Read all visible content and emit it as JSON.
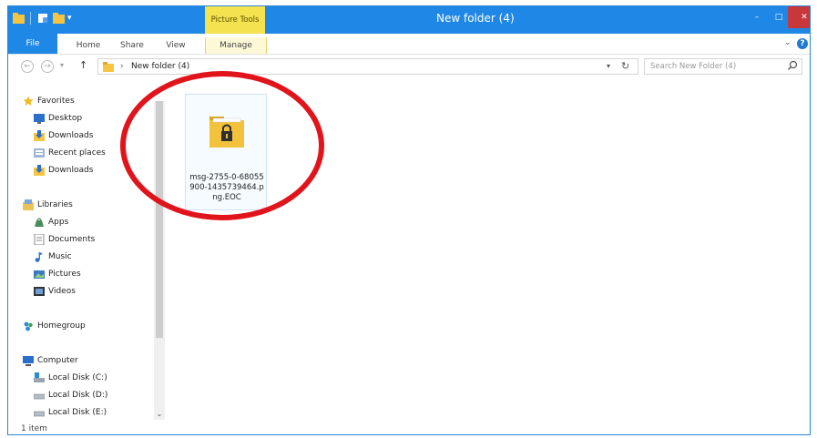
{
  "window": {
    "title": "New folder (4)",
    "context_tab": "Picture Tools",
    "controls": {
      "minimize": "–",
      "maximize": "□",
      "close": "✕"
    }
  },
  "ribbon": {
    "tabs": [
      {
        "label": "File"
      },
      {
        "label": "Home"
      },
      {
        "label": "Share"
      },
      {
        "label": "View"
      },
      {
        "label": "Manage"
      }
    ],
    "help": "?"
  },
  "address": {
    "path": "New folder (4)",
    "search_placeholder": "Search New Folder (4)"
  },
  "nav_pane": {
    "favorites": {
      "label": "Favorites",
      "items": [
        {
          "label": "Desktop",
          "icon": "desktop-icon"
        },
        {
          "label": "Downloads",
          "icon": "downloads-icon"
        },
        {
          "label": "Recent places",
          "icon": "recent-places-icon"
        },
        {
          "label": "Downloads",
          "icon": "downloads-icon"
        }
      ]
    },
    "libraries": {
      "label": "Libraries",
      "items": [
        {
          "label": "Apps",
          "icon": "apps-icon"
        },
        {
          "label": "Documents",
          "icon": "documents-icon"
        },
        {
          "label": "Music",
          "icon": "music-icon"
        },
        {
          "label": "Pictures",
          "icon": "pictures-icon"
        },
        {
          "label": "Videos",
          "icon": "videos-icon"
        }
      ]
    },
    "homegroup": {
      "label": "Homegroup"
    },
    "computer": {
      "label": "Computer",
      "items": [
        {
          "label": "Local Disk (C:)",
          "icon": "local-disk-c-icon"
        },
        {
          "label": "Local Disk (D:)",
          "icon": "local-disk-icon"
        },
        {
          "label": "Local Disk (E:)",
          "icon": "local-disk-icon"
        }
      ]
    }
  },
  "content": {
    "files": [
      {
        "name": "msg-2755-0-68055900-1435739464.png.EOC",
        "icon": "locked-folder-icon"
      }
    ]
  },
  "status": {
    "item_count": "1 item"
  },
  "colors": {
    "title_bar": "#1f87e6",
    "context_tab": "#f5e24f",
    "close_button": "#c8383a",
    "annotation_oval": "#e1141c"
  }
}
